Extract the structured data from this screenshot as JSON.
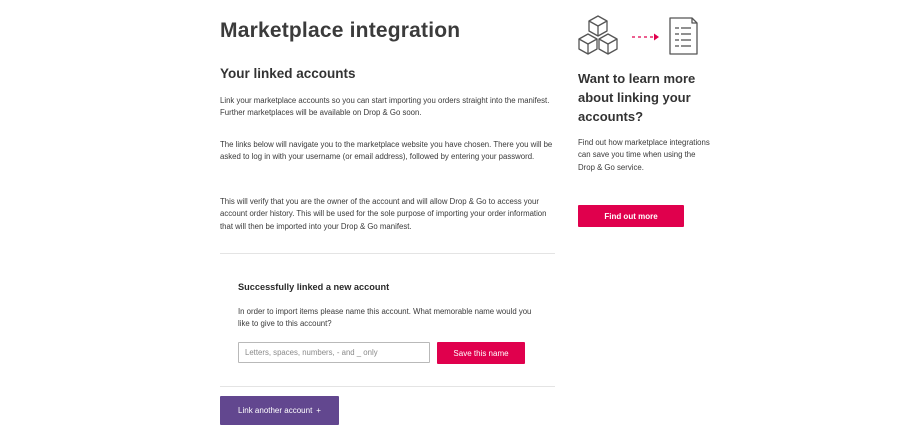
{
  "main": {
    "title": "Marketplace integration",
    "section_title": "Your linked accounts",
    "paragraphs": [
      "Link your marketplace accounts so you can start importing you orders straight into the manifest. Further marketplaces will be available on Drop & Go soon.",
      "The links below will navigate you to the marketplace website you have chosen. There you will be asked to log in with your username (or email address), followed by entering your password.",
      "This will verify that you are the owner of the account and will allow Drop & Go to access your account order history. This will be used for the sole purpose of importing your order information that will then be imported into your Drop & Go manifest."
    ]
  },
  "linked": {
    "title": "Successfully linked a new account",
    "text": "In order to import items please name this account. What memorable name would you like to give to this account?",
    "input_placeholder": "Letters, spaces, numbers, - and _ only",
    "input_value": "",
    "save_label": "Save this name"
  },
  "link_another": {
    "label": "Link another account",
    "icon_glyph": "+"
  },
  "sidebar": {
    "illustration_icons": [
      "boxes-icon",
      "arrow-icon",
      "document-icon"
    ],
    "title": "Want to learn more about linking your accounts?",
    "text": "Find out how marketplace integrations can save you time when using the Drop & Go service.",
    "button_label": "Find out more"
  },
  "colors": {
    "accent": "#e0004d",
    "purple": "#62478f",
    "text": "#333333",
    "divider": "#e4e4e4"
  }
}
